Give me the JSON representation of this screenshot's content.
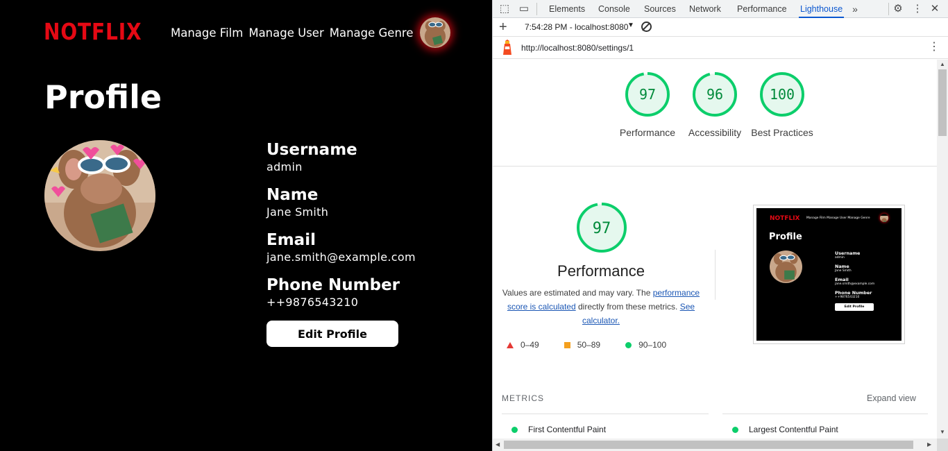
{
  "app": {
    "logo": "NOTFLIX",
    "nav": [
      "Manage Film",
      "Manage User",
      "Manage Genre"
    ],
    "page_title": "Profile",
    "fields": [
      {
        "label": "Username",
        "value": "admin"
      },
      {
        "label": "Name",
        "value": "Jane Smith"
      },
      {
        "label": "Email",
        "value": "jane.smith@example.com"
      },
      {
        "label": "Phone Number",
        "value": "++9876543210"
      }
    ],
    "edit_button": "Edit Profile",
    "avatar_glow_color": "#e50914"
  },
  "devtools": {
    "tabs": [
      "Elements",
      "Console",
      "Sources",
      "Network",
      "Performance",
      "Lighthouse"
    ],
    "active_tab": "Lighthouse",
    "more_tabs_icon": "chevron-double-right-icon",
    "report_selector": "7:54:28 PM - localhost:8080",
    "url": "http://localhost:8080/settings/1",
    "scores": [
      {
        "label": "Performance",
        "value": 97
      },
      {
        "label": "Accessibility",
        "value": 96
      },
      {
        "label": "Best Practices",
        "value": 100
      }
    ],
    "performance": {
      "score": 97,
      "title": "Performance",
      "desc_prefix": "Values are estimated and may vary. The ",
      "desc_link1": "performance score is calculated",
      "desc_middle": " directly from these metrics. ",
      "desc_link2": "See calculator."
    },
    "legend": [
      {
        "range": "0–49",
        "color": "#e53935"
      },
      {
        "range": "50–89",
        "color": "#f4a01f"
      },
      {
        "range": "90–100",
        "color": "#0cce6b"
      }
    ],
    "metrics_heading": "METRICS",
    "expand_view": "Expand view",
    "metrics": [
      "First Contentful Paint",
      "Largest Contentful Paint"
    ],
    "pass_color": "#0cce6b"
  }
}
